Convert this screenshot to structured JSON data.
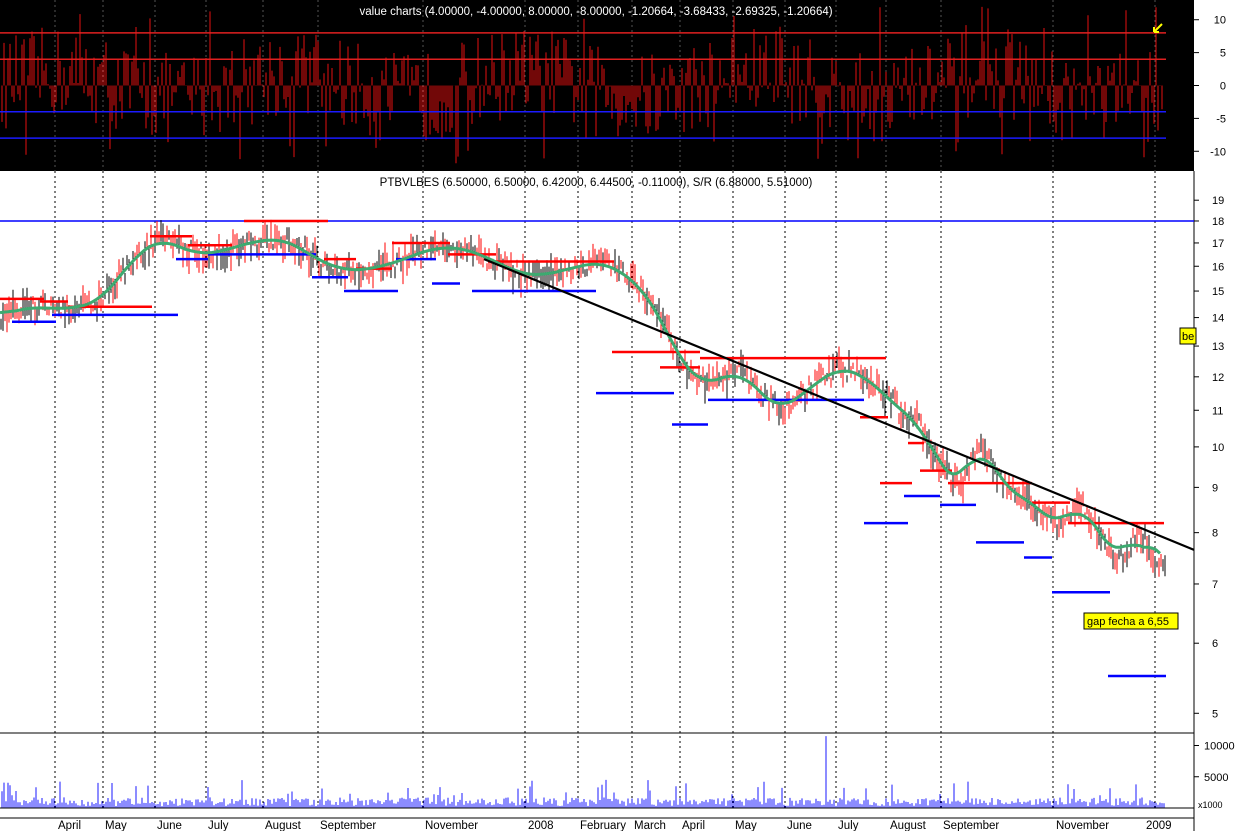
{
  "colors": {
    "upper_bg": "#000000",
    "osc_line": "#d01010",
    "upper_red_level": "#e02020",
    "upper_blue_level": "#1a1aff",
    "sr_red": "#ff0000",
    "sr_blue": "#0000ff",
    "trend_line": "#000000",
    "ma_line": "#3daa70",
    "annotation_bg": "#ffff00",
    "grid": "#000000"
  },
  "chart_data": [
    {
      "type": "bar",
      "title": "value charts (4.00000, -4.00000, 8.00000, -8.00000, -1.20664, -3.68433, -2.69325, -1.20664)",
      "ylim": [
        -13,
        13
      ],
      "ticks": [
        10,
        5,
        0,
        -5,
        -10
      ],
      "levels": [
        {
          "value": 8,
          "color": "red"
        },
        {
          "value": 4,
          "color": "red"
        },
        {
          "value": -4,
          "color": "blue"
        },
        {
          "value": -8,
          "color": "blue"
        }
      ],
      "grid": false
    },
    {
      "type": "line",
      "title": "PTBVLBES (6.50000, 6.50000, 6.42000, 6.44500, -0.11000), S/R (6.88000, 5.51000)",
      "scale": "log",
      "ylim": [
        4.75,
        20.5
      ],
      "ticks": [
        19,
        18,
        17,
        16,
        15,
        14,
        13,
        12,
        11,
        10,
        9,
        8,
        7,
        6,
        5
      ],
      "x": [
        0,
        20,
        40,
        60,
        80,
        100,
        120,
        140,
        160,
        180,
        200,
        220,
        240,
        260,
        280,
        300,
        320,
        340,
        360,
        380,
        400,
        420,
        440,
        460,
        480,
        500,
        520,
        540,
        560,
        580,
        600,
        620,
        640,
        660,
        680,
        700,
        720,
        740,
        760,
        780,
        800,
        820,
        840,
        860,
        880,
        900,
        920,
        940,
        960,
        980,
        1000,
        1020,
        1040,
        1060,
        1080,
        1100,
        1120,
        1140,
        1160
      ],
      "series": [
        {
          "values": [
            14.1,
            14.3,
            14.4,
            14.3,
            14.4,
            14.6,
            15.6,
            16.6,
            17.2,
            16.8,
            16.5,
            16.6,
            16.9,
            17.1,
            17.2,
            16.8,
            16.2,
            15.9,
            15.8,
            16.0,
            16.2,
            16.6,
            16.8,
            16.8,
            16.5,
            16.1,
            15.7,
            15.6,
            15.8,
            16.0,
            16.2,
            15.8,
            15.2,
            14.0,
            12.5,
            11.8,
            11.9,
            12.2,
            11.5,
            11.0,
            11.4,
            11.9,
            12.3,
            12.1,
            11.6,
            11.0,
            10.6,
            9.5,
            9.0,
            10.2,
            9.1,
            8.8,
            8.5,
            8.1,
            8.7,
            7.9,
            7.5,
            8.0,
            7.3
          ]
        }
      ],
      "support_resistance": [
        {
          "type": "resistance",
          "from": 0,
          "to": 44,
          "value": 14.7
        },
        {
          "type": "support",
          "from": 12,
          "to": 56,
          "value": 13.85
        },
        {
          "type": "resistance",
          "from": 40,
          "to": 68,
          "value": 14.6
        },
        {
          "type": "support",
          "from": 52,
          "to": 178,
          "value": 14.1
        },
        {
          "type": "resistance",
          "from": 68,
          "to": 152,
          "value": 14.4
        },
        {
          "type": "resistance",
          "from": 150,
          "to": 192,
          "value": 17.3
        },
        {
          "type": "support",
          "from": 176,
          "to": 208,
          "value": 16.3
        },
        {
          "type": "resistance",
          "from": 188,
          "to": 232,
          "value": 16.9
        },
        {
          "type": "support",
          "from": 208,
          "to": 316,
          "value": 16.5
        },
        {
          "type": "resistance",
          "from": 244,
          "to": 328,
          "value": 18.0
        },
        {
          "type": "support",
          "from": 312,
          "to": 348,
          "value": 15.55
        },
        {
          "type": "resistance",
          "from": 324,
          "to": 356,
          "value": 16.3
        },
        {
          "type": "support",
          "from": 344,
          "to": 398,
          "value": 15.0
        },
        {
          "type": "resistance",
          "from": 356,
          "to": 392,
          "value": 15.9
        },
        {
          "type": "support",
          "from": 396,
          "to": 436,
          "value": 16.3
        },
        {
          "type": "resistance",
          "from": 392,
          "to": 450,
          "value": 17.0
        },
        {
          "type": "support",
          "from": 432,
          "to": 460,
          "value": 15.3
        },
        {
          "type": "resistance",
          "from": 448,
          "to": 496,
          "value": 16.5
        },
        {
          "type": "support",
          "from": 472,
          "to": 596,
          "value": 15.0
        },
        {
          "type": "resistance",
          "from": 488,
          "to": 614,
          "value": 16.2
        },
        {
          "type": "resistance",
          "from": 612,
          "to": 700,
          "value": 12.8
        },
        {
          "type": "support",
          "from": 596,
          "to": 674,
          "value": 11.5
        },
        {
          "type": "resistance",
          "from": 660,
          "to": 700,
          "value": 12.3
        },
        {
          "type": "support",
          "from": 672,
          "to": 708,
          "value": 10.6
        },
        {
          "type": "resistance",
          "from": 700,
          "to": 886,
          "value": 12.6
        },
        {
          "type": "support",
          "from": 708,
          "to": 864,
          "value": 11.3
        },
        {
          "type": "resistance",
          "from": 860,
          "to": 888,
          "value": 10.8
        },
        {
          "type": "support",
          "from": 864,
          "to": 908,
          "value": 8.2
        },
        {
          "type": "resistance",
          "from": 880,
          "to": 912,
          "value": 9.1
        },
        {
          "type": "resistance",
          "from": 908,
          "to": 924,
          "value": 10.1
        },
        {
          "type": "support",
          "from": 904,
          "to": 940,
          "value": 8.8
        },
        {
          "type": "resistance",
          "from": 920,
          "to": 952,
          "value": 9.4
        },
        {
          "type": "support",
          "from": 940,
          "to": 976,
          "value": 8.6
        },
        {
          "type": "resistance",
          "from": 948,
          "to": 1032,
          "value": 9.1
        },
        {
          "type": "support",
          "from": 976,
          "to": 1024,
          "value": 7.8
        },
        {
          "type": "resistance",
          "from": 1032,
          "to": 1070,
          "value": 8.65
        },
        {
          "type": "support",
          "from": 1024,
          "to": 1052,
          "value": 7.5
        },
        {
          "type": "resistance",
          "from": 1068,
          "to": 1164,
          "value": 8.2
        },
        {
          "type": "support",
          "from": 1052,
          "to": 1110,
          "value": 6.85
        },
        {
          "type": "support",
          "from": 1108,
          "to": 1166,
          "value": 5.51
        }
      ],
      "trendline": {
        "from": [
          484,
          16.3
        ],
        "to": [
          1194,
          7.65
        ]
      },
      "resistance_level": 18.0,
      "annotation": "gap fecha a 6,55",
      "side_marker": "be",
      "grid": false
    },
    {
      "type": "bar",
      "title": "",
      "ylim": [
        0,
        12000
      ],
      "ticks": [
        10000,
        5000
      ],
      "unit_label": "x1000",
      "grid": false
    }
  ],
  "x_axis": {
    "labels": [
      "April",
      "May",
      "June",
      "July",
      "August",
      "September",
      "November",
      "2008",
      "February",
      "March",
      "April",
      "May",
      "June",
      "July",
      "August",
      "September",
      "November",
      "2009"
    ]
  }
}
